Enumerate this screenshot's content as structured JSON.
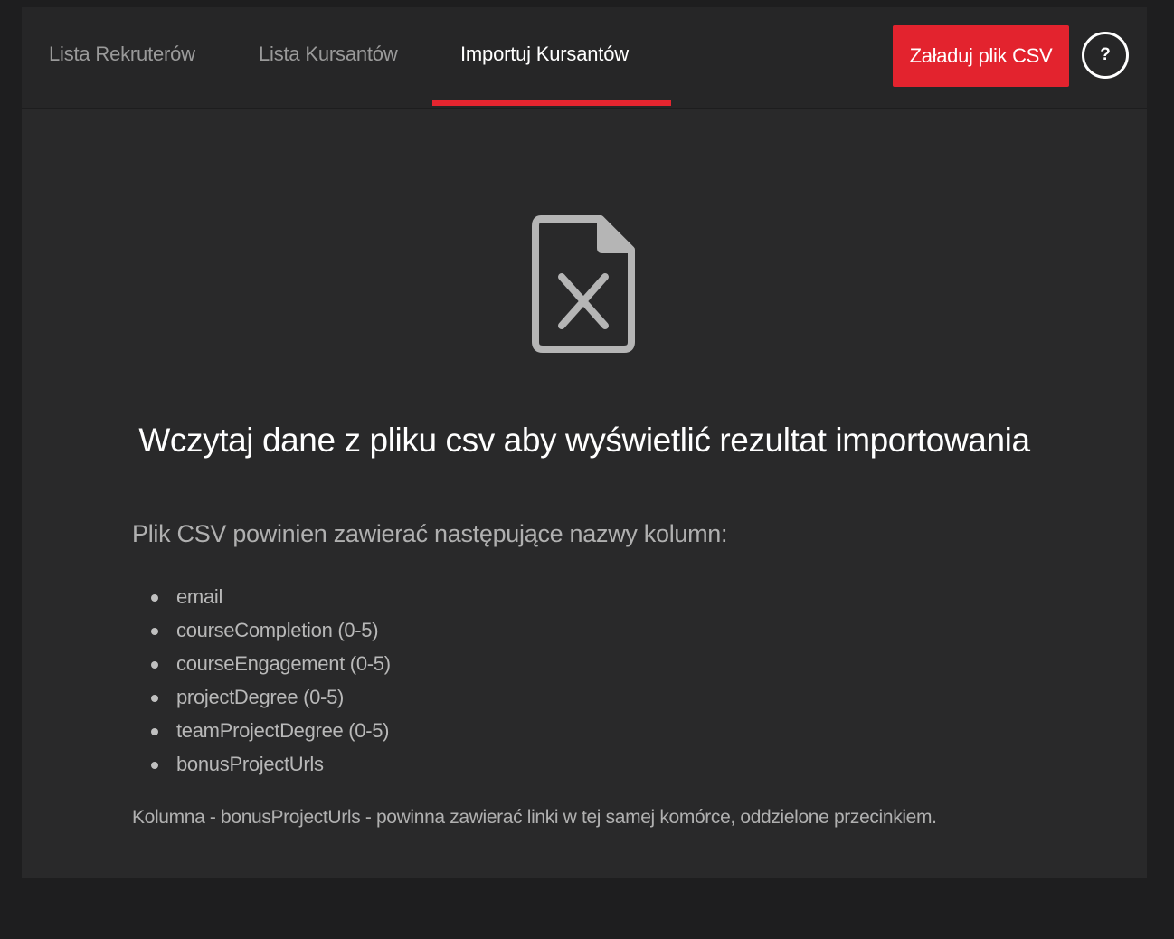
{
  "nav": {
    "tabs": [
      {
        "label": "Lista Rekruterów",
        "active": false
      },
      {
        "label": "Lista Kursantów",
        "active": false
      },
      {
        "label": "Importuj Kursantów",
        "active": true
      }
    ],
    "upload_button_label": "Załaduj plik CSV",
    "help_button_label": "?"
  },
  "empty_state": {
    "icon": "file-excel-icon",
    "headline": "Wczytaj dane z pliku csv aby wyświetlić rezultat importowania"
  },
  "instructions": {
    "heading": "Plik CSV powinien zawierać następujące nazwy kolumn:",
    "columns": [
      "email",
      "courseCompletion (0-5)",
      "courseEngagement (0-5)",
      "projectDegree (0-5)",
      "teamProjectDegree (0-5)",
      "bonusProjectUrls"
    ],
    "note": "Kolumna - bonusProjectUrls - powinna zawierać linki w tej samej komórce, oddzielone przecinkiem."
  },
  "colors": {
    "accent": "#e3232e",
    "background": "#1e1e1f",
    "panel": "#29292a",
    "topbar": "#262627",
    "icon": "#b5b5b5"
  }
}
